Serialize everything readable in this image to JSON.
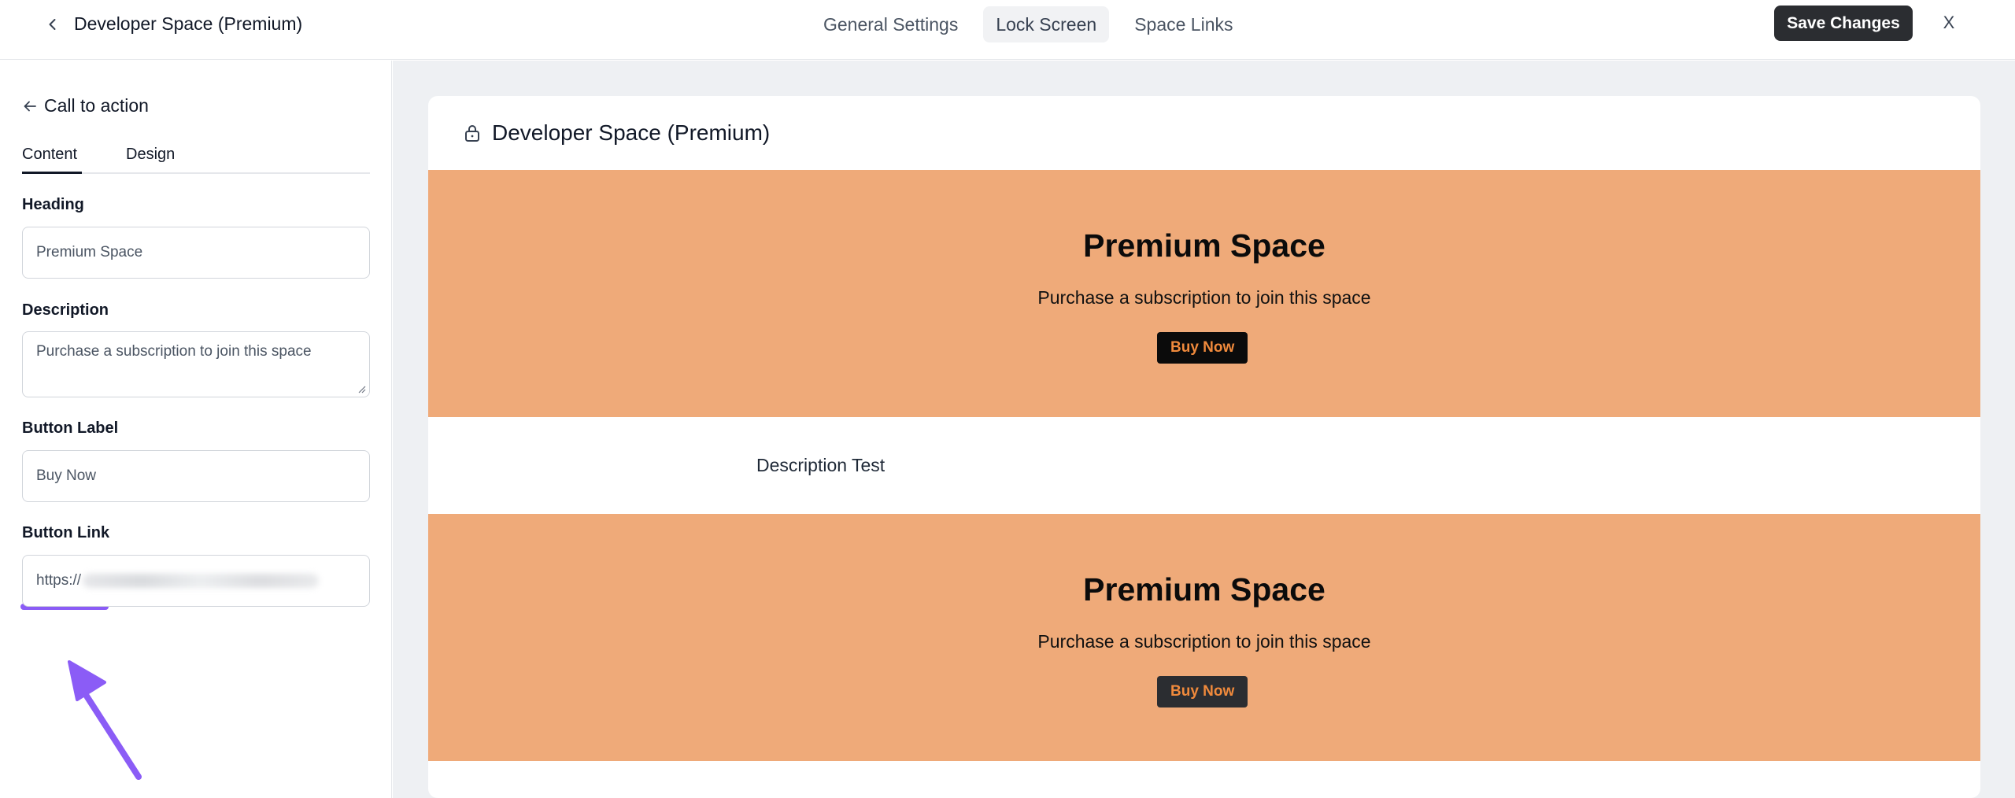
{
  "topbar": {
    "space_title": "Developer Space (Premium)",
    "tabs": [
      {
        "label": "General Settings",
        "active": false
      },
      {
        "label": "Lock Screen",
        "active": true
      },
      {
        "label": "Space Links",
        "active": false
      }
    ],
    "save_label": "Save Changes",
    "close_label": "X"
  },
  "sidebar": {
    "section_title": "Call to action",
    "tabs": [
      {
        "label": "Content",
        "active": true
      },
      {
        "label": "Design",
        "active": false
      }
    ],
    "fields": {
      "heading": {
        "label": "Heading",
        "value": "Premium Space"
      },
      "description": {
        "label": "Description",
        "value": "Purchase a subscription to join this space"
      },
      "button_label": {
        "label": "Button Label",
        "value": "Buy Now"
      },
      "button_link": {
        "label": "Button Link",
        "value_visible": "https://"
      }
    }
  },
  "preview": {
    "title": "Developer Space (Premium)",
    "blocks": [
      {
        "heading": "Premium Space",
        "description": "Purchase a subscription to join this space",
        "button": "Buy Now",
        "button_bg": "#0b0b0b"
      },
      {
        "heading": "Premium Space",
        "description": "Purchase a subscription to join this space",
        "button": "Buy Now",
        "button_bg": "#2b2d31"
      }
    ],
    "description_text": "Description Test"
  },
  "colors": {
    "hero_bg": "#efaa79",
    "button_text": "#f08a3c",
    "primary_dark": "#2b2d31",
    "annotation_purple": "#8b5cf6"
  },
  "icons": [
    "chevron-left-icon",
    "arrow-left-icon",
    "lock-icon",
    "annotation-arrow-icon"
  ]
}
